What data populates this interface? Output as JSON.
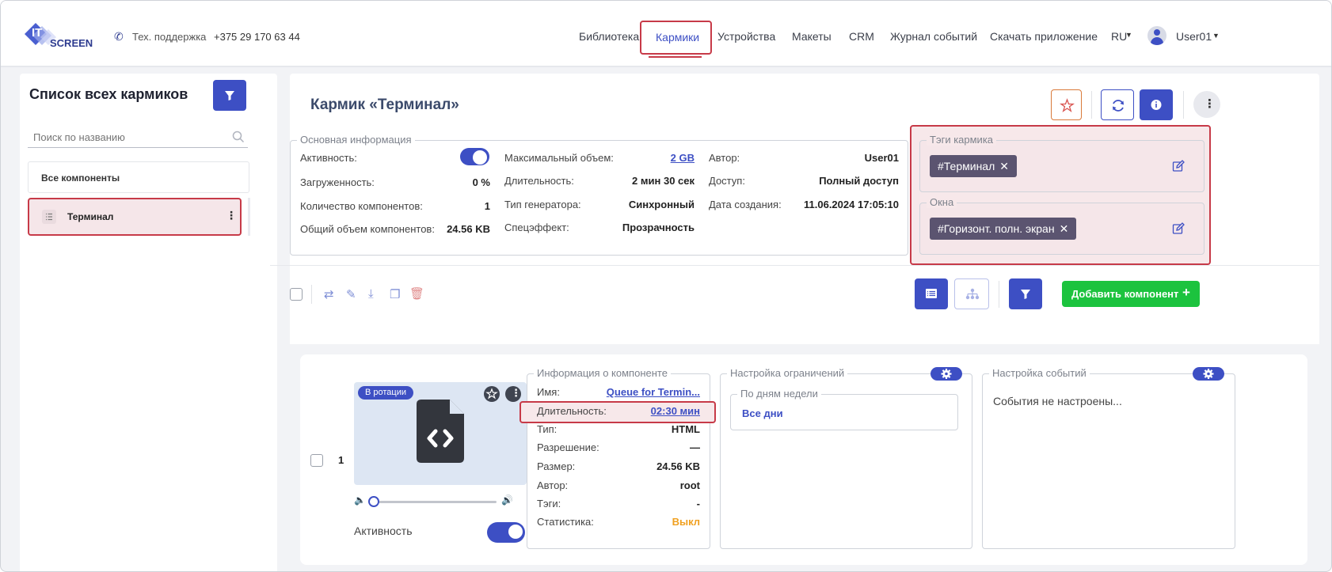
{
  "header": {
    "logo_it": "IT",
    "logo_screen": "SCREEN",
    "support_label": "Тех. поддержка",
    "support_phone": "+375 29 170 63 44",
    "nav": [
      "Библиотека",
      "Кармики",
      "Устройства",
      "Макеты",
      "CRM",
      "Журнал событий",
      "Скачать приложение"
    ],
    "lang": "RU",
    "user": "User01"
  },
  "sidebar": {
    "title": "Список всех кармиков",
    "search_placeholder": "Поиск по названию",
    "all_components": "Все компоненты",
    "items": [
      "Терминал"
    ]
  },
  "karmik": {
    "title": "Кармик «Терминал»",
    "basic_info": {
      "legend": "Основная информация",
      "col1": [
        {
          "label": "Активность:",
          "value": ""
        },
        {
          "label": "Загруженность:",
          "value": "0 %"
        },
        {
          "label": "Количество компонентов:",
          "value": "1"
        },
        {
          "label": "Общий объем компонентов:",
          "value": "24.56 KB"
        }
      ],
      "col2": [
        {
          "label": "Максимальный объем:",
          "value": "2 GB"
        },
        {
          "label": "Длительность:",
          "value": "2 мин 30 сек"
        },
        {
          "label": "Тип генератора:",
          "value": "Синхронный"
        },
        {
          "label": "Спецэффект:",
          "value": "Прозрачность"
        }
      ],
      "col3": [
        {
          "label": "Автор:",
          "value": "User01"
        },
        {
          "label": "Доступ:",
          "value": "Полный доступ"
        },
        {
          "label": "Дата создания:",
          "value": "11.06.2024 17:05:10"
        }
      ]
    },
    "tags": {
      "legend": "Тэги кармика",
      "tag": "#Терминал",
      "windows_legend": "Окна",
      "window_tag": "#Горизонт. полн. экран"
    }
  },
  "toolbar": {
    "add_button": "Добавить компонент"
  },
  "component": {
    "index": "1",
    "rotation_badge": "В ротации",
    "activity_label": "Активность",
    "info": {
      "legend": "Информация о компоненте",
      "rows": [
        {
          "label": "Имя:",
          "value": "Queue for Termin..."
        },
        {
          "label": "Длительность:",
          "value": "02:30 мин"
        },
        {
          "label": "Тип:",
          "value": "HTML"
        },
        {
          "label": "Разрешение:",
          "value": "—"
        },
        {
          "label": "Размер:",
          "value": "24.56 KB"
        },
        {
          "label": "Автор:",
          "value": "root"
        },
        {
          "label": "Тэги:",
          "value": "-"
        },
        {
          "label": "Статистика:",
          "value": "Выкл"
        }
      ]
    },
    "restrictions": {
      "legend": "Настройка ограничений",
      "weekdays_legend": "По дням недели",
      "weekdays_value": "Все дни"
    },
    "events": {
      "legend": "Настройка событий",
      "text": "События не настроены..."
    }
  },
  "colors": {
    "primary": "#3d4fc4",
    "highlight": "#c73a48",
    "add_button": "#1cc33e",
    "status_off": "#f0a020"
  }
}
